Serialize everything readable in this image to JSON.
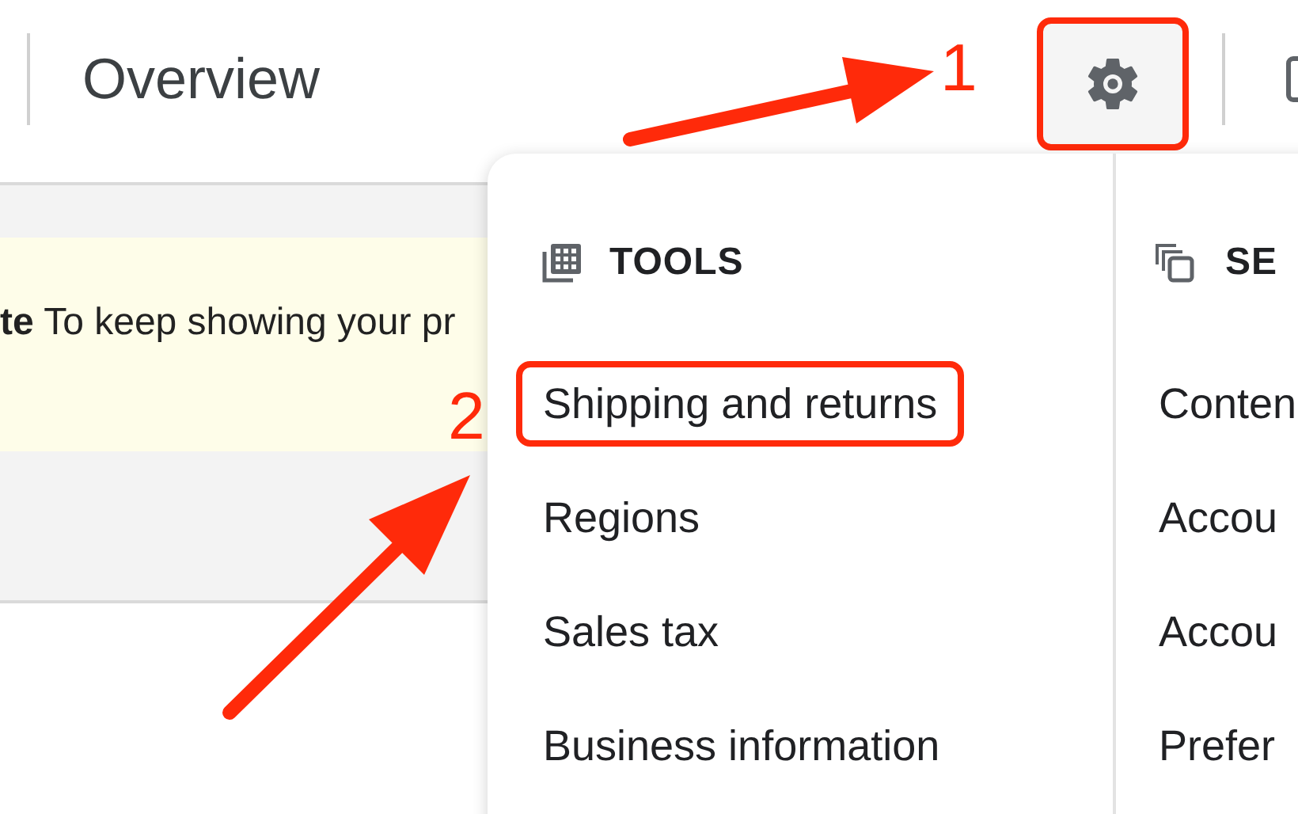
{
  "page": {
    "title": "Overview"
  },
  "toolbar": {
    "settings_button": {
      "highlighted": true
    }
  },
  "notice": {
    "text": "**te** To keep showing your pr"
  },
  "menu": {
    "sections": [
      {
        "kind": "tools",
        "heading": "TOOLS",
        "items": [
          {
            "label": "Shipping and returns",
            "highlighted": true
          },
          {
            "label": "Regions",
            "highlighted": false
          },
          {
            "label": "Sales tax",
            "highlighted": false
          },
          {
            "label": "Business information",
            "highlighted": false
          }
        ]
      },
      {
        "kind": "settings",
        "heading": "SE",
        "items": [
          {
            "label": "Conten",
            "highlighted": false
          },
          {
            "label": "Accou",
            "highlighted": false
          },
          {
            "label": "Accou",
            "highlighted": false
          },
          {
            "label": "Prefer",
            "highlighted": false
          }
        ]
      }
    ]
  },
  "annotations": [
    {
      "label": "1"
    },
    {
      "label": "2"
    }
  ]
}
